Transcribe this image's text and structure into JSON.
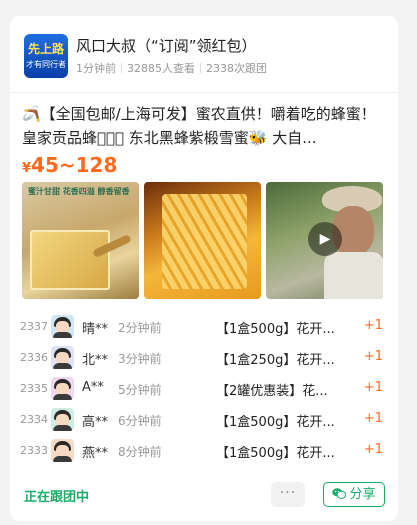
{
  "header": {
    "avatar_line1": "先上路",
    "avatar_line2": "才有同行者",
    "title": "风口大叔（“订阅”领红包）",
    "meta": {
      "time": "1分钟前",
      "views": "32885人查看",
      "followers": "2338次跟团"
    }
  },
  "post": {
    "description": "🪃【全国包邮/上海可发】蜜农直供！嚼着吃的蜂蜜！皇家贡品蜂蜜🏻🏻 东北黑蜂紫椴雪蜜🐝 大自...",
    "price_currency": "¥",
    "price_range": "45~128",
    "photos": [
      {
        "name": "honey-box-photo",
        "caption": "蜜汁甘甜  花香四溢  醇香留香"
      },
      {
        "name": "honeycomb-photo"
      },
      {
        "name": "beekeeper-video-thumbnail",
        "is_video": true
      }
    ]
  },
  "orders": [
    {
      "num": "2337",
      "name": "晴**",
      "time": "2分钟前",
      "item": "【1盒500g】花开...",
      "qty": "+1",
      "avatar_bg": "#cfe6f5"
    },
    {
      "num": "2336",
      "name": "北**",
      "time": "3分钟前",
      "item": "【1盒250g】花开...",
      "qty": "+1",
      "avatar_bg": "#dfe3f7"
    },
    {
      "num": "2335",
      "name": "A**",
      "time": "5分钟前",
      "item": "【2罐优惠装】花...",
      "qty": "+1",
      "avatar_bg": "#efd8f0"
    },
    {
      "num": "2334",
      "name": "高**",
      "time": "6分钟前",
      "item": "【1盒500g】花开...",
      "qty": "+1",
      "avatar_bg": "#cfeee3"
    },
    {
      "num": "2333",
      "name": "燕**",
      "time": "8分钟前",
      "item": "【1盒500g】花开...",
      "qty": "+1",
      "avatar_bg": "#f6dcc6"
    }
  ],
  "footer": {
    "status": "正在跟团中",
    "more_label": "···",
    "share_label": "分享"
  },
  "colors": {
    "accent": "#ff6a1f",
    "green": "#1aad6a"
  },
  "icons": [
    "play-icon",
    "wechat-icon",
    "more-icon"
  ]
}
